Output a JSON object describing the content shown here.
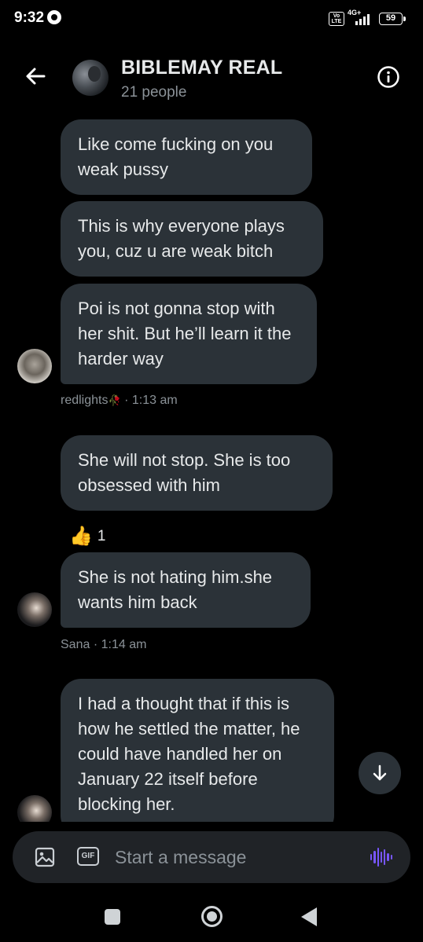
{
  "status_bar": {
    "time": "9:32",
    "volte": "Vo LTE",
    "network": "4G+",
    "battery": "59"
  },
  "header": {
    "title": "BIBLEMAY REAL",
    "subtitle": "21 people"
  },
  "messages": [
    {
      "text": "Like come fucking on you weak pussy"
    },
    {
      "text": "This is why everyone plays you, cuz u are weak bitch"
    },
    {
      "text": "Poi is not gonna stop with her shit. But he’ll learn it the harder way"
    },
    {
      "text": "She will not stop. She is too obsessed with him"
    },
    {
      "text": "She is not hating him.she wants him back"
    },
    {
      "text": "I had a thought that if this is how he settled the matter, he could have handled her on January 22 itself before blocking her."
    }
  ],
  "meta": {
    "group1_sender": "redlights",
    "group1_emoji": "🥀",
    "group1_time": "· 1:13 am",
    "group2_sender": "Sana",
    "group2_time": "· 1:14 am"
  },
  "reaction": {
    "emoji": "👍",
    "count": "1"
  },
  "composer": {
    "gif_label": "GIF",
    "placeholder": "Start a message"
  },
  "icons": {
    "back": "arrow-left-icon",
    "info": "info-icon",
    "scroll": "arrow-down-icon",
    "image": "image-icon",
    "voice": "voice-wave-icon"
  },
  "colors": {
    "bubble": "#2b3238",
    "accent": "#7856ff",
    "muted_text": "#8b9298"
  }
}
